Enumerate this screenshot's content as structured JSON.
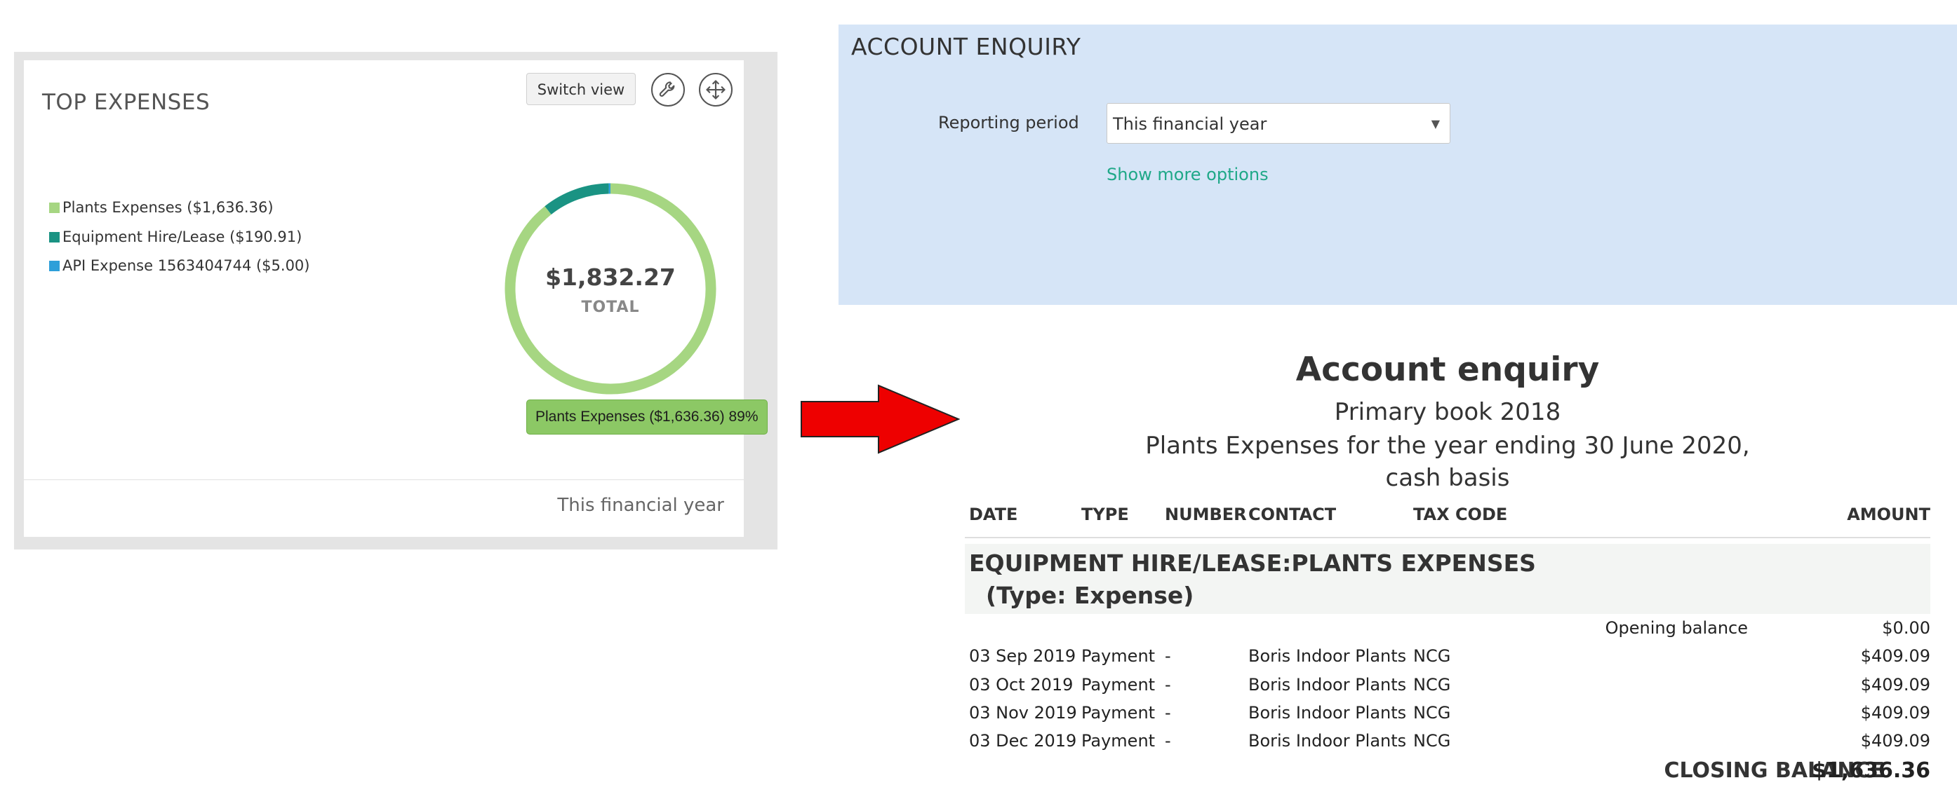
{
  "widget": {
    "title": "TOP EXPENSES",
    "switch_view_label": "Switch view",
    "footer_period": "This financial year",
    "total_value": "$1,832.27",
    "total_label": "TOTAL",
    "tooltip": "Plants Expenses ($1,636.36) 89%",
    "legend": [
      {
        "label": "Plants Expenses ($1,636.36)",
        "color": "#a6d682"
      },
      {
        "label": "Equipment Hire/Lease ($190.91)",
        "color": "#1a9383"
      },
      {
        "label": "API Expense 1563404744 ($5.00)",
        "color": "#2e9fd9"
      }
    ]
  },
  "chart_data": {
    "type": "pie",
    "categories": [
      "Plants Expenses",
      "Equipment Hire/Lease",
      "API Expense 1563404744"
    ],
    "values": [
      1636.36,
      190.91,
      5.0
    ],
    "colors": [
      "#a6d682",
      "#1a9383",
      "#2e9fd9"
    ],
    "title": "TOP EXPENSES",
    "legend": "left"
  },
  "enquiry": {
    "title": "ACCOUNT ENQUIRY",
    "period_label": "Reporting period",
    "period_value": "This financial year",
    "more_options": "Show more options"
  },
  "report": {
    "title": "Account enquiry",
    "book": "Primary book 2018",
    "subtitle_line1": "Plants Expenses for the year ending 30 June 2020,",
    "subtitle_line2": "cash basis",
    "columns": {
      "date": "DATE",
      "type": "TYPE",
      "number": "NUMBER",
      "contact": "CONTACT",
      "tax_code": "TAX CODE",
      "amount": "AMOUNT"
    },
    "account_name": "EQUIPMENT HIRE/LEASE:PLANTS EXPENSES",
    "account_type": "(Type: Expense)",
    "opening_label": "Opening balance",
    "opening_value": "$0.00",
    "rows": [
      {
        "date": "03 Sep 2019",
        "type": "Payment",
        "number": "-",
        "contact": "Boris Indoor Plants",
        "tax_code": "NCG",
        "amount": "$409.09"
      },
      {
        "date": "03 Oct 2019",
        "type": "Payment",
        "number": "-",
        "contact": "Boris Indoor Plants",
        "tax_code": "NCG",
        "amount": "$409.09"
      },
      {
        "date": "03 Nov 2019",
        "type": "Payment",
        "number": "-",
        "contact": "Boris Indoor Plants",
        "tax_code": "NCG",
        "amount": "$409.09"
      },
      {
        "date": "03 Dec 2019",
        "type": "Payment",
        "number": "-",
        "contact": "Boris Indoor Plants",
        "tax_code": "NCG",
        "amount": "$409.09"
      }
    ],
    "closing_label": "CLOSING BALANCE",
    "closing_value": "$1,636.36"
  },
  "icons": {
    "settings": "wrench-icon",
    "move": "move-arrows-icon",
    "arrow": "right-arrow-icon",
    "caret": "caret-down-icon"
  },
  "colors": {
    "panel_bg": "#d6e5f7",
    "link": "#1fa888",
    "arrow": "#ee0000",
    "tooltip_bg": "#8cc865"
  }
}
